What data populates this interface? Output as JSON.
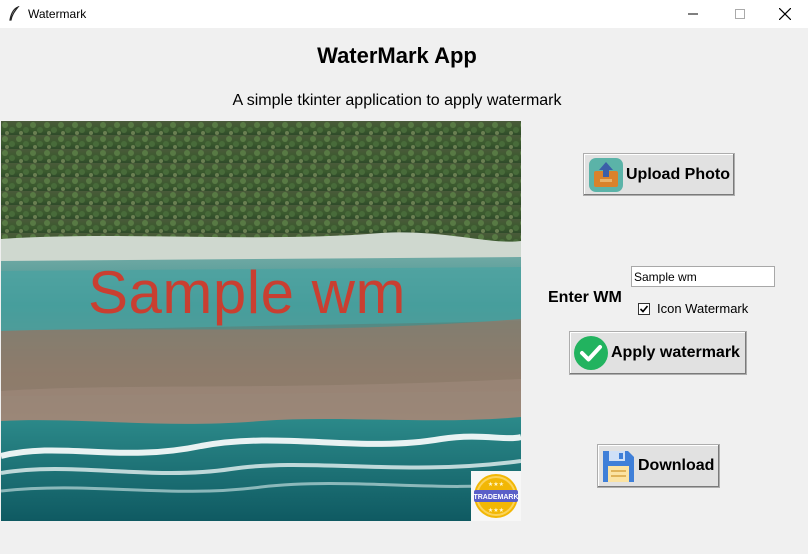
{
  "window": {
    "title": "Watermark"
  },
  "app": {
    "title": "WaterMark App",
    "subtitle": "A simple tkinter application to apply watermark"
  },
  "preview": {
    "watermark_text": "Sample wm",
    "badge_text": "TRADEMARK"
  },
  "controls": {
    "upload_label": "Upload Photo",
    "enter_wm_label": "Enter WM",
    "wm_input_value": "Sample wm",
    "icon_watermark_label": "Icon Watermark",
    "icon_watermark_checked": true,
    "apply_label": "Apply watermark",
    "download_label": "Download"
  },
  "colors": {
    "watermark": "#d03a2c",
    "apply_icon": "#22b35f",
    "download_icon": "#3f7fd8"
  }
}
